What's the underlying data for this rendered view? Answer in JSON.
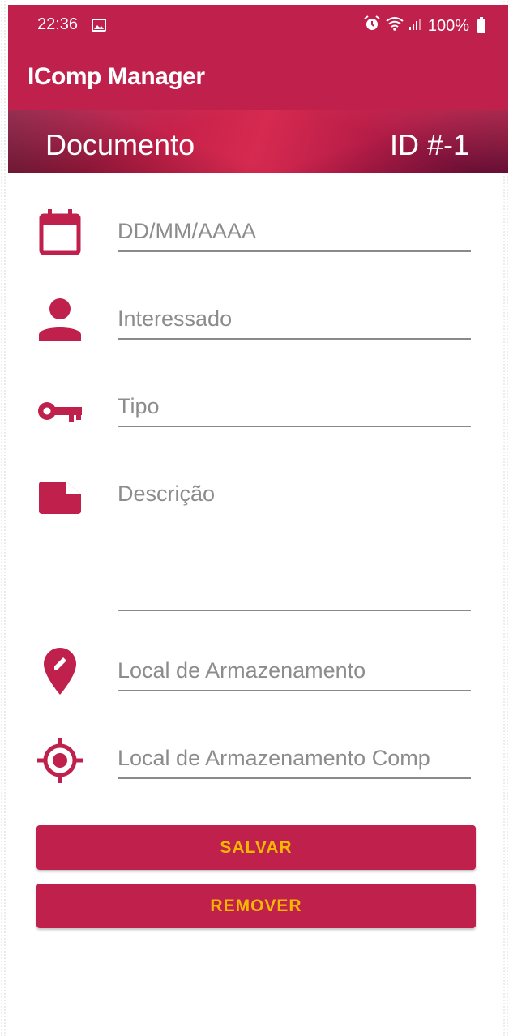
{
  "status_bar": {
    "time": "22:36",
    "battery": "100%",
    "icons": [
      "image-icon",
      "alarm-icon",
      "wifi-icon",
      "signal-icon",
      "battery-icon"
    ]
  },
  "app_bar": {
    "title": "IComp Manager"
  },
  "banner": {
    "label": "Documento",
    "id": "ID #-1"
  },
  "form": {
    "date": {
      "placeholder": "DD/MM/AAAA",
      "icon": "calendar-icon"
    },
    "interessado": {
      "placeholder": "Interessado",
      "icon": "person-icon"
    },
    "tipo": {
      "placeholder": "Tipo",
      "icon": "key-icon"
    },
    "descricao": {
      "placeholder": "Descrição",
      "icon": "note-icon"
    },
    "local": {
      "placeholder": "Local de Armazenamento",
      "icon": "edit-location-icon"
    },
    "local_comp": {
      "placeholder": "Local de Armazenamento Comp",
      "icon": "target-icon"
    }
  },
  "buttons": {
    "save": "SALVAR",
    "remove": "REMOVER"
  },
  "colors": {
    "primary": "#bf204c",
    "accent": "#f5b800"
  }
}
